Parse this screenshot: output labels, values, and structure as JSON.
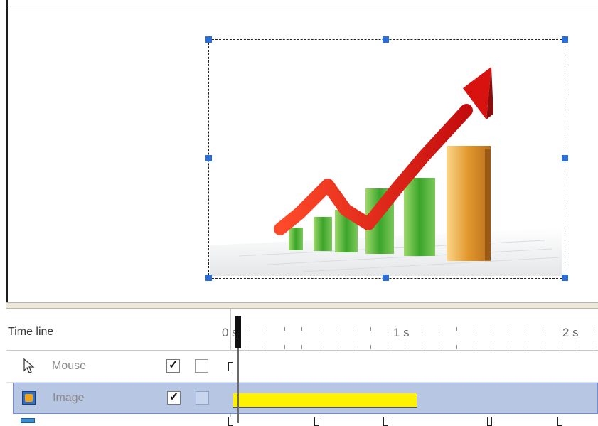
{
  "timeline": {
    "title": "Time line",
    "ruler": {
      "label_0": "0 s",
      "label_1": "1 s",
      "label_2": "2 s"
    },
    "tracks": [
      {
        "label": "Mouse",
        "visible_checked": true,
        "locked_checked": false,
        "icon": "cursor-arrow-icon"
      },
      {
        "label": "Image",
        "visible_checked": true,
        "locked_checked": false,
        "icon": "image-object-icon",
        "selected": true
      }
    ]
  },
  "stage": {
    "selected_object": "image",
    "image_icon": "growth-chart-arrow-image"
  },
  "colors": {
    "selection_handle": "#2b6fd6",
    "selected_row": "#b7c6e3",
    "clip_bar": "#fff200"
  }
}
